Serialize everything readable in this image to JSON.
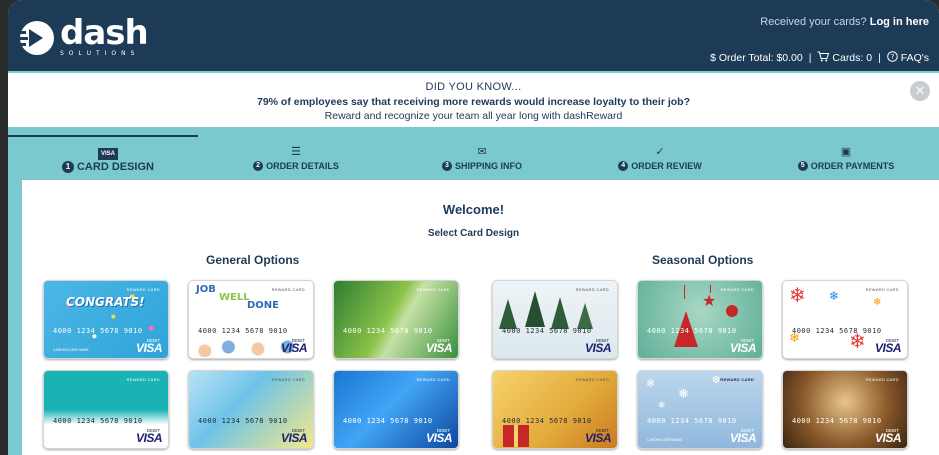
{
  "brand": {
    "name": "dash",
    "sub": "SOLUTIONS"
  },
  "header": {
    "received_text": "Received your cards?",
    "login_text": "Log in here",
    "order_total": "$ Order Total: $0.00",
    "cards": "Cards: 0",
    "faq": "FAQ's"
  },
  "banner": {
    "line1": "DID YOU KNOW...",
    "line2": "79% of employees say that receiving more rewards would increase loyalty to their job?",
    "line3": "Reward and recognize your team all year long with dashReward",
    "close": "✕"
  },
  "steps": [
    {
      "num": "1",
      "label": "CARD DESIGN",
      "icon": "visa-card-icon",
      "icon_text": "VISA"
    },
    {
      "num": "2",
      "label": "ORDER DETAILS",
      "icon": "list-icon",
      "icon_text": "☰"
    },
    {
      "num": "3",
      "label": "SHIPPING INFO",
      "icon": "envelope-icon",
      "icon_text": "✉"
    },
    {
      "num": "4",
      "label": "ORDER REVIEW",
      "icon": "check-icon",
      "icon_text": "✓"
    },
    {
      "num": "5",
      "label": "ORDER PAYMENTS",
      "icon": "money-icon",
      "icon_text": "▣"
    }
  ],
  "main": {
    "welcome": "Welcome!",
    "select": "Select Card Design",
    "general_title": "General Options",
    "seasonal_title": "Seasonal Options"
  },
  "card": {
    "reward": "REWARD CARD",
    "digits": "4000  1234  5678  9010",
    "debit": "DEBIT",
    "visa": "VISA",
    "holder": "CARDHOLDER NAME",
    "congrats": "CONGRATS!",
    "job": "JOB",
    "well": "WELL",
    "done": "DONE"
  },
  "colors": {
    "navy": "#1d3a57",
    "teal": "#7ac9cf",
    "white": "#ffffff"
  }
}
